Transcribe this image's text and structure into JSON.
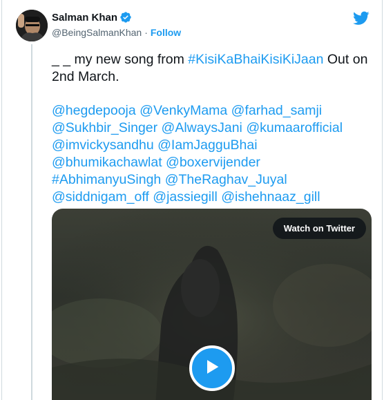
{
  "tweet": {
    "author_name": "Salman Khan",
    "author_handle": "@BeingSalmanKhan",
    "separator": "·",
    "follow_label": "Follow",
    "text_prefix": "_ _ my new song from ",
    "hashtag_main": "#KisiKaBhaiKisiKiJaan",
    "text_suffix": " Out on 2nd March.",
    "mentions": [
      "@hegdepooja",
      "@VenkyMama",
      "@farhad_samji",
      "@Sukhbir_Singer",
      "@AlwaysJani",
      "@kumaarofficial",
      "@imvickysandhu",
      "@IamJagguBhai",
      "@bhumikachawlat",
      "@boxervijender",
      "#AbhimanyuSingh",
      "@TheRaghav_Juyal",
      "@siddnigam_off",
      "@jassiegill",
      "@ishehnaaz_gill"
    ]
  },
  "media": {
    "watch_label": "Watch on Twitter"
  },
  "icons": {
    "verified": "verified-badge-icon",
    "logo": "twitter-bird-icon",
    "play": "play-icon"
  },
  "colors": {
    "accent": "#1d9bf0",
    "text": "#0f1419",
    "secondary": "#536471",
    "border": "#cfd9de"
  }
}
